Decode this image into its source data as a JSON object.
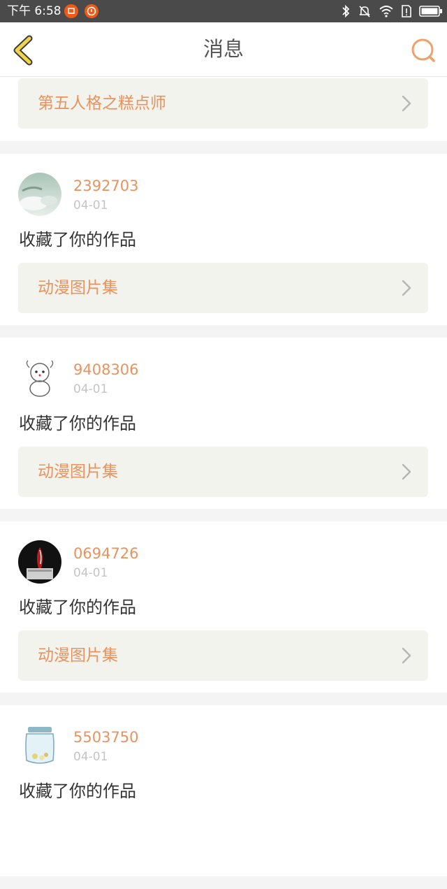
{
  "status_bar": {
    "time": "下午 6:58",
    "icons": [
      "notification-app-icon",
      "notification-alert-icon",
      "bluetooth-icon",
      "silent-bell-icon",
      "wifi-icon",
      "sim-alert-icon",
      "battery-icon"
    ]
  },
  "header": {
    "title": "消息",
    "back_icon": "back-chevron-icon",
    "search_icon": "search-icon"
  },
  "colors": {
    "accent": "#e8935f",
    "link_bg": "#f3f3ee",
    "back_icon": "#f0d44c",
    "status_bar": "#4a4a4a"
  },
  "messages": [
    {
      "work_title": "第五人格之糕点师"
    },
    {
      "username": "2392703",
      "date": "04-01",
      "action": "收藏了你的作品",
      "work_title": "动漫图片集"
    },
    {
      "username": "9408306",
      "date": "04-01",
      "action": "收藏了你的作品",
      "work_title": "动漫图片集"
    },
    {
      "username": "0694726",
      "date": "04-01",
      "action": "收藏了你的作品",
      "work_title": "动漫图片集"
    },
    {
      "username": "5503750",
      "date": "04-01",
      "action": "收藏了你的作品"
    }
  ]
}
